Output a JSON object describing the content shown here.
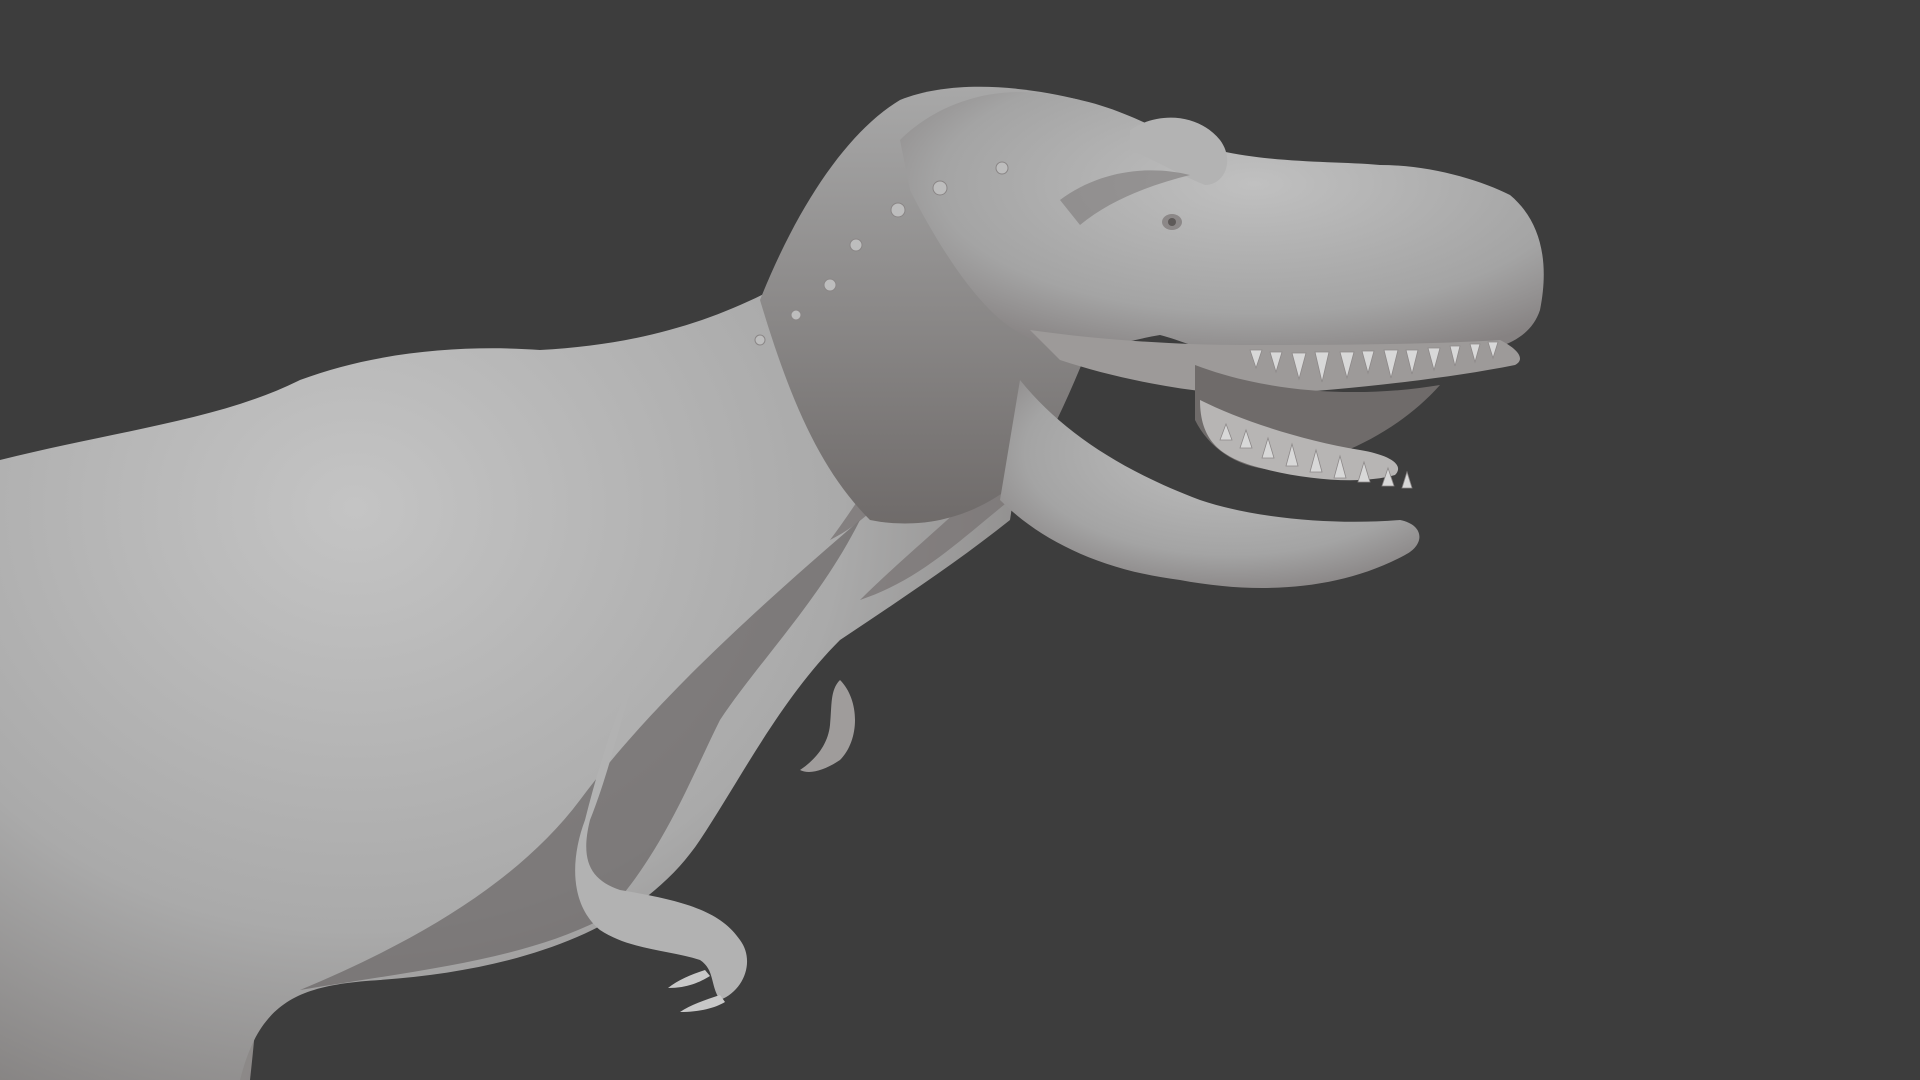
{
  "viewport": {
    "background_color": "#3d3d3d",
    "model": {
      "name": "t-rex-sculpt",
      "base_color": "#a9a9a9",
      "highlight_color": "#c4c4c4",
      "shadow_color": "#6e6a69",
      "mouth_color": "#8e8b8a",
      "teeth_color": "#d8d8d8"
    }
  }
}
